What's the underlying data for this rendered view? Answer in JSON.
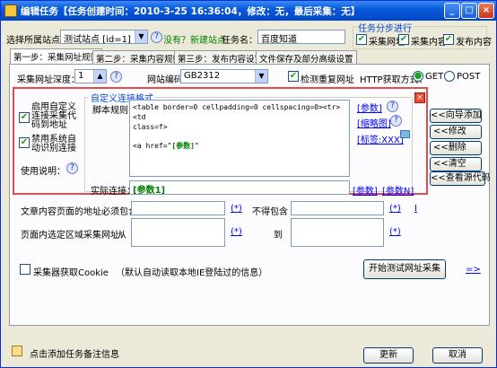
{
  "window": {
    "title": "编辑任务【任务创建时间：2010-3-25 16:36:04，修改：无，最后采集：无】",
    "min": "_",
    "max": "□",
    "close": "×"
  },
  "top": {
    "site_label": "选择所属站点：",
    "site_value": "测试站点 [id=1]",
    "site_warn": "没有？新建站点",
    "name_label": "任务名：",
    "name_value": "百度知道",
    "steps_legend": "任务分步进行",
    "step_collect_url": "采集网址",
    "step_collect_content": "采集内容",
    "step_publish": "发布内容"
  },
  "tabs": [
    "第一步：采集网址规则",
    "第二步：采集内容规则",
    "第三步：发布内容设置",
    "文件保存及部分高级设置"
  ],
  "row1": {
    "depth_label": "采集网址深度：",
    "depth_value": "1",
    "encoding_label": "网站编码：",
    "encoding_value": "GB2312",
    "dedupe_label": "检测重复网址",
    "method_label": "HTTP获取方式：",
    "get": "GET",
    "post": "POST"
  },
  "left_opts": {
    "custom_label": "启用自定义连接采集代码到地址",
    "filter_label": "禁用系统自动识别连接",
    "usage_label": "使用说明："
  },
  "custom": {
    "legend": "自定义连接格式",
    "script_label": "脚本规则：",
    "script_line1": "<table border=0 cellpadding=0 cellspacing=0><tr><td",
    "script_line2": "class=f>",
    "script_line3": "<a href=\"",
    "script_param": "[参数]",
    "script_line3_end": "\"",
    "actual_label": "实际连接：",
    "actual_value": "[参数1]",
    "side_param": "[参数]",
    "side_thumb": "[缩略图]",
    "side_tag": "[标签:XXX]",
    "bottom_param": "[参数]",
    "bottom_paramN": "[参数N]"
  },
  "right_btns": [
    "<<向导添加",
    "<<修改",
    "<<删除",
    "<<清空",
    "<<查看源代码"
  ],
  "filters": {
    "must_label": "文章内容页面的地址必须包含：",
    "must_not": "不得包含",
    "region_label": "页面内选定区域采集网址：",
    "from": "从",
    "to": "到",
    "ins": "(*)",
    "i": "I"
  },
  "cookie": {
    "label": "采集器获取Cookie",
    "note": "（默认自动读取本地IE登陆过的信息）",
    "test_btn": "开始测试网址采集",
    "arrow": "=>"
  },
  "footer": {
    "note_label": "点击添加任务备注信息",
    "update": "更新",
    "cancel": "取消"
  }
}
